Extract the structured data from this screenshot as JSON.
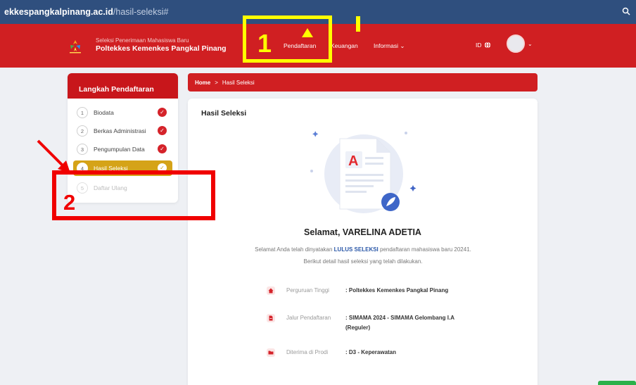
{
  "browser": {
    "url_domain": "ekkespangkalpinang.ac.id",
    "url_path": "/hasil-seleksi#"
  },
  "header": {
    "subtitle": "Seleksi Penerimaan Mahasiswa Baru",
    "title": "Poltekkes Kemenkes Pangkal Pinang",
    "nav": [
      "Pendaftaran",
      "Keuangan",
      "Informasi"
    ],
    "nav_caret": "⌄",
    "lang": "ID"
  },
  "annotations": {
    "label_1": "1",
    "label_2": "2",
    "box1_color": "#ffff00",
    "box2_color": "#f00000"
  },
  "sidebar": {
    "title": "Langkah Pendaftaran",
    "steps": [
      {
        "num": "1",
        "label": "Biodata",
        "state": "done"
      },
      {
        "num": "2",
        "label": "Berkas Administrasi",
        "state": "done"
      },
      {
        "num": "3",
        "label": "Pengumpulan Data",
        "state": "done"
      },
      {
        "num": "4",
        "label": "Hasil Seleksi",
        "state": "active"
      },
      {
        "num": "5",
        "label": "Daftar Ulang",
        "state": "disabled"
      }
    ]
  },
  "breadcrumb": {
    "home": "Home",
    "separator": ">",
    "current": "Hasil Seleksi"
  },
  "main": {
    "title": "Hasil Seleksi",
    "greeting": "Selamat, VARELINA ADETIA",
    "message_pre": "Selamat Anda telah dinyatakan ",
    "message_highlight": "LULUS SELEKSI",
    "message_post": " pendaftaran mahasiswa baru 20241. Berikut detail hasil seleksi yang telah dilakukan.",
    "details": [
      {
        "icon": "home-icon",
        "label": "Perguruan Tinggi",
        "value": ": Poltekkes Kemenkes Pangkal Pinang"
      },
      {
        "icon": "document-icon",
        "label": "Jalur Pendaftaran",
        "value": ": SIMAMA 2024 - SIMAMA Gelombang I.A (Reguler)"
      },
      {
        "icon": "folder-icon",
        "label": "Diterima di Prodi",
        "value": ": D3 - Keperawatan"
      }
    ]
  },
  "colors": {
    "brand_red": "#d01f22",
    "active_step": "#d5a318",
    "highlight_blue": "#2b58a8"
  }
}
